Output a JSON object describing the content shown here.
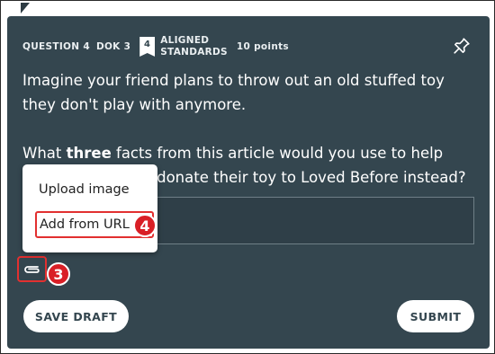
{
  "question": {
    "number_label": "QUESTION 4",
    "dok_label": "DOK 3",
    "standards_count": "4",
    "standards_label_line1": "ALIGNED",
    "standards_label_line2": "STANDARDS",
    "points_label": "10 points"
  },
  "prompt": {
    "paragraph1": "Imagine your friend plans to throw out an old stuffed toy they don't play with anymore.",
    "paragraph2_before": "What ",
    "paragraph2_bold": "three",
    "paragraph2_after": " facts from this article would you use to help convince them to donate their toy to Loved Before instead?"
  },
  "attach_menu": {
    "upload_label": "Upload image",
    "url_label": "Add from URL"
  },
  "callouts": {
    "attach_step": "3",
    "url_step": "4"
  },
  "actions": {
    "save_draft_label": "SAVE DRAFT",
    "submit_label": "SUBMIT"
  },
  "icons": {
    "pin": "pin-icon",
    "attach": "paperclip-icon",
    "badge": "bookmark-icon"
  },
  "colors": {
    "card_bg": "#34464f",
    "highlight": "#e23030",
    "callout": "#d91f26"
  }
}
